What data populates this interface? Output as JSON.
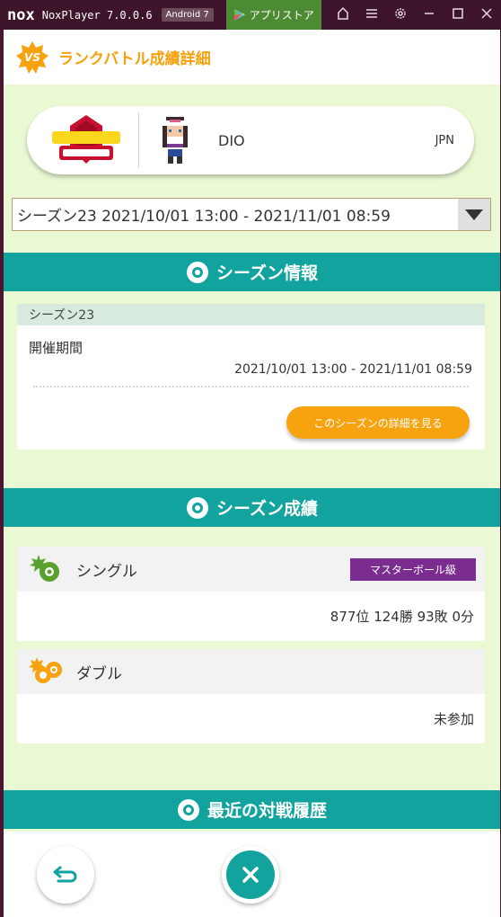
{
  "titlebar": {
    "logo": "nox",
    "version": "NoxPlayer 7.0.0.6",
    "android_badge": "Android 7",
    "appstore_label": "アプリストア",
    "icons": [
      "home-icon",
      "menu-icon",
      "gear-icon",
      "minimize-icon",
      "maximize-icon",
      "close-icon"
    ]
  },
  "header": {
    "badge": "VS",
    "title": "ランクバトル成績詳細"
  },
  "player": {
    "name": "DIO",
    "region": "JPN"
  },
  "season_select": {
    "selected": "シーズン23 2021/10/01 13:00 - 2021/11/01 08:59"
  },
  "season_info": {
    "section_title": "シーズン情報",
    "season_name": "シーズン23",
    "period_label": "開催期間",
    "period_value": "2021/10/01 13:00 - 2021/11/01 08:59",
    "detail_button": "このシーズンの詳細を見る"
  },
  "season_results": {
    "section_title": "シーズン成績",
    "single": {
      "label": "シングル",
      "rank": "マスターボール級",
      "value": "877位 124勝 93敗 0分"
    },
    "double": {
      "label": "ダブル",
      "value": "未参加"
    }
  },
  "recent": {
    "section_title": "最近の対戦履歴"
  },
  "colors": {
    "teal": "#12a39e",
    "orange": "#f7a20f",
    "purple": "#7b2d8f",
    "background": "#eaf9d4"
  }
}
